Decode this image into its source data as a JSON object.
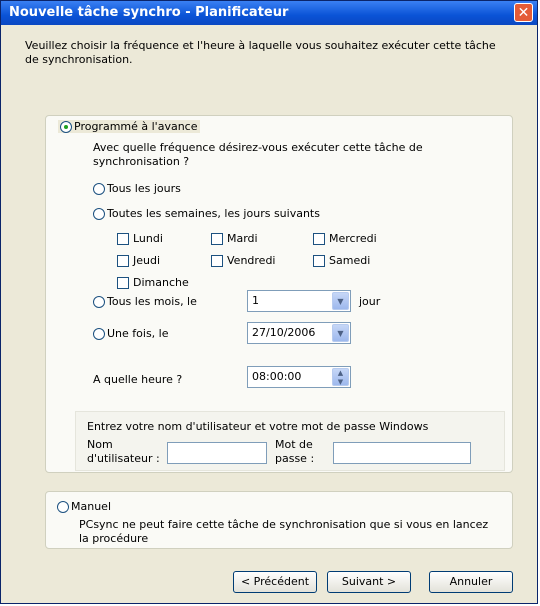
{
  "window": {
    "title": "Nouvelle tâche synchro - Planificateur",
    "close_symbol": "✕"
  },
  "intro_text": "Veuillez choisir la fréquence et l'heure à laquelle vous souhaitez exécuter cette tâche de synchronisation.",
  "scheduled": {
    "label": "Programmé à l'avance",
    "selected": true,
    "question": "Avec quelle fréquence désirez-vous exécuter cette tâche de synchronisation ?",
    "options": {
      "daily": "Tous les jours",
      "weekly": "Toutes les semaines, les jours suivants",
      "monthly": "Tous les mois, le",
      "once": "Une fois, le"
    },
    "days": {
      "lundi": "Lundi",
      "mardi": "Mardi",
      "mercredi": "Mercredi",
      "jeudi": "Jeudi",
      "vendredi": "Vendredi",
      "samedi": "Samedi",
      "dimanche": "Dimanche"
    },
    "monthly_day_value": "1",
    "monthly_suffix": "jour",
    "once_date_value": "27/10/2006",
    "time_label": "A quelle heure ?",
    "time_value": "08:00:00",
    "credentials": {
      "prompt": "Entrez votre nom d'utilisateur et votre mot de passe Windows",
      "username_label_line1": "Nom",
      "username_label_line2": "d'utilisateur :",
      "password_label_line1": "Mot de",
      "password_label_line2": "passe :",
      "username_value": "",
      "password_value": ""
    }
  },
  "manual": {
    "label": "Manuel",
    "selected": false,
    "description": "PCsync ne peut faire cette tâche de synchronisation que si vous en lancez la procédure"
  },
  "buttons": {
    "previous": "< Précédent",
    "next": "Suivant >",
    "cancel": "Annuler"
  }
}
